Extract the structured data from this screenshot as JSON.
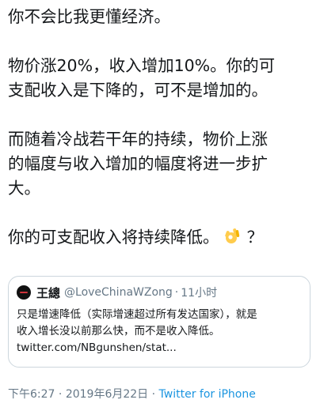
{
  "tweet": {
    "paragraphs": [
      [
        "你不会比我更懂经济。"
      ],
      [
        "物价涨20%，收入增加10%。你的可",
        "支配收入是下降的，可不是增加的。"
      ],
      [
        "而随着冷战若干年的持续，物价上涨",
        "的幅度与收入增加的幅度将进一步扩",
        "大。"
      ],
      [
        "你的可支配收入将持续降低。",
        "？"
      ]
    ],
    "emoji": "ok-hand-emoji"
  },
  "quote": {
    "name": "王總",
    "handle": "@LoveChinaWZong",
    "separator": "·",
    "time": "11小时",
    "lines": [
      "只是增速降低（实际增速超过所有发达国家），就是",
      "收入增长没以前那么快，而不是收入降低。",
      "twitter.com/NBgunshen/stat..."
    ]
  },
  "meta": {
    "time": "下午6:27",
    "separator1": " · ",
    "date": "2019年6月22日",
    "separator2": " · ",
    "source": "Twitter for iPhone"
  },
  "colors": {
    "text": "#14171a",
    "secondary": "#657786",
    "link": "#1b95e0",
    "border": "#ccd6dd"
  }
}
